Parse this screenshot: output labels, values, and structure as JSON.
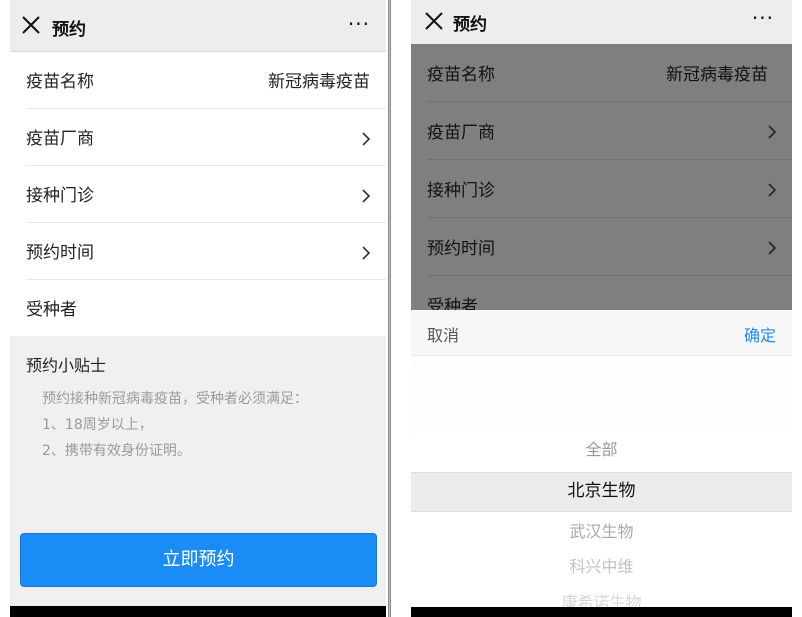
{
  "left": {
    "nav": {
      "title": "预约",
      "more": "···"
    },
    "rows": [
      {
        "label": "疫苗名称",
        "value": "新冠病毒疫苗"
      },
      {
        "label": "疫苗厂商"
      },
      {
        "label": "接种门诊"
      },
      {
        "label": "预约时间"
      },
      {
        "label": "受种者"
      }
    ],
    "tips": {
      "title": "预约小贴士",
      "lines": [
        "预约接种新冠病毒疫苗，受种者必须满足：",
        "1、18周岁以上，",
        "2、携带有效身份证明。"
      ]
    },
    "button": "立即预约"
  },
  "right": {
    "nav": {
      "title": "预约",
      "more": "···"
    },
    "rows": [
      {
        "label": "疫苗名称",
        "value": "新冠病毒疫苗"
      },
      {
        "label": "疫苗厂商"
      },
      {
        "label": "接种门诊"
      },
      {
        "label": "预约时间"
      },
      {
        "label": "受种者"
      }
    ],
    "picker": {
      "cancel": "取消",
      "confirm": "确定",
      "options": [
        "全部",
        "北京生物",
        "武汉生物",
        "科兴中维",
        "康希诺生物"
      ],
      "selected": "北京生物"
    }
  },
  "colors": {
    "accent": "#1a8cf5",
    "overlay": "#7f7f7f"
  }
}
